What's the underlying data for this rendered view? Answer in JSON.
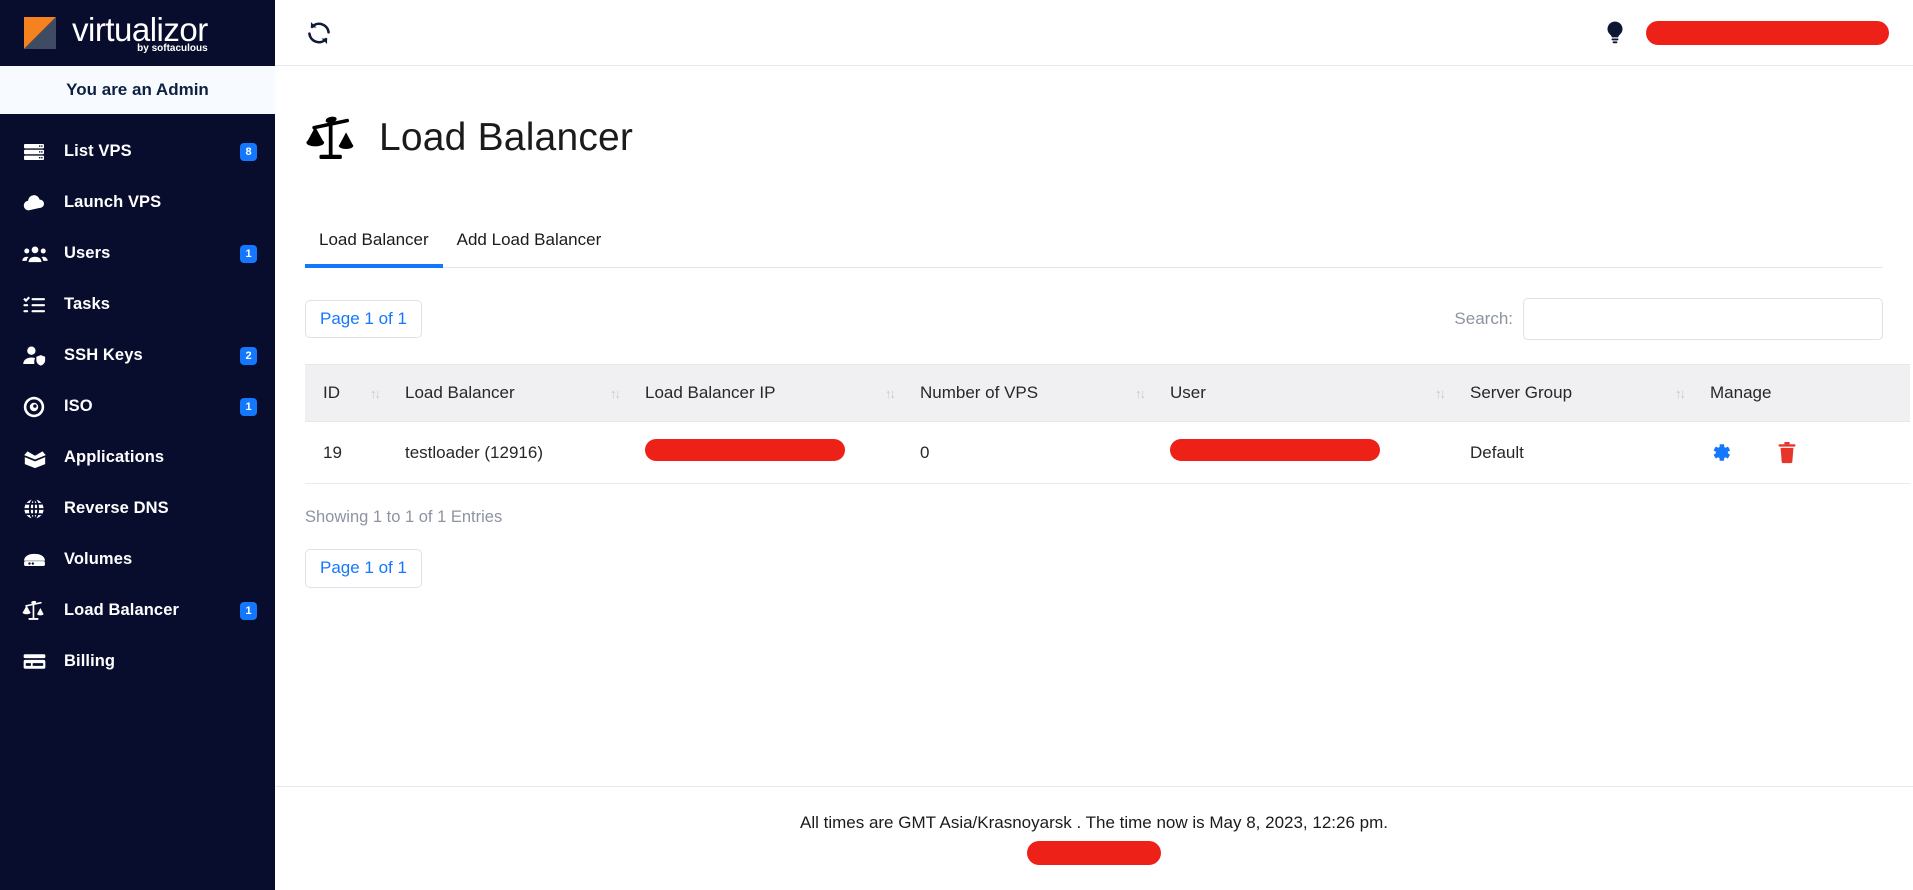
{
  "brand": {
    "name": "virtualizor",
    "tagline": "by softaculous",
    "logo_orange": "#f5821f",
    "logo_slate": "#3f4a63"
  },
  "sidebar": {
    "admin_banner": "You are an Admin",
    "background": "#080d2e",
    "badge_color": "#1478ff",
    "items": [
      {
        "label": "List VPS",
        "icon": "server-icon",
        "badge": "8"
      },
      {
        "label": "Launch VPS",
        "icon": "cloud-upload-icon",
        "badge": ""
      },
      {
        "label": "Users",
        "icon": "users-icon",
        "badge": "1"
      },
      {
        "label": "Tasks",
        "icon": "tasks-icon",
        "badge": ""
      },
      {
        "label": "SSH Keys",
        "icon": "user-shield-icon",
        "badge": "2"
      },
      {
        "label": "ISO",
        "icon": "disc-icon",
        "badge": "1"
      },
      {
        "label": "Applications",
        "icon": "open-box-icon",
        "badge": ""
      },
      {
        "label": "Reverse DNS",
        "icon": "globe-icon",
        "badge": ""
      },
      {
        "label": "Volumes",
        "icon": "drive-icon",
        "badge": ""
      },
      {
        "label": "Load Balancer",
        "icon": "scales-icon",
        "badge": "1"
      },
      {
        "label": "Billing",
        "icon": "credit-card-icon",
        "badge": ""
      }
    ]
  },
  "topbar": {
    "refresh_icon": "refresh-icon",
    "bulb_icon": "lightbulb-icon",
    "redacted_label": "",
    "redaction_color": "#ee2119"
  },
  "page": {
    "icon": "scales-icon",
    "title": "Load Balancer"
  },
  "tabs": [
    {
      "label": "Load Balancer",
      "active": true
    },
    {
      "label": "Add Load Balancer",
      "active": false
    }
  ],
  "toolbar": {
    "page_button_top": "Page 1 of 1",
    "page_button_bottom": "Page 1 of 1",
    "search_label": "Search:",
    "search_value": "",
    "search_placeholder": ""
  },
  "table": {
    "columns": [
      {
        "label": "ID",
        "sortable": true
      },
      {
        "label": "Load Balancer",
        "sortable": true
      },
      {
        "label": "Load Balancer IP",
        "sortable": true
      },
      {
        "label": "Number of VPS",
        "sortable": true
      },
      {
        "label": "User",
        "sortable": true
      },
      {
        "label": "Server Group",
        "sortable": true
      },
      {
        "label": "Manage",
        "sortable": false
      }
    ],
    "sort_glyph": "↑↓",
    "rows": [
      {
        "id": "19",
        "load_balancer": "testloader (12916)",
        "load_balancer_ip": "",
        "load_balancer_ip_redacted": true,
        "number_of_vps": "0",
        "user": "",
        "user_redacted": true,
        "server_group": "Default",
        "manage_edit_icon": "gear-icon",
        "manage_delete_icon": "trash-icon"
      }
    ],
    "showing_text": "Showing 1 to 1 of 1 Entries"
  },
  "footer": {
    "text": "All times are GMT Asia/Krasnoyarsk . The time now is May 8, 2023, 12:26 pm.",
    "redacted_label": ""
  }
}
